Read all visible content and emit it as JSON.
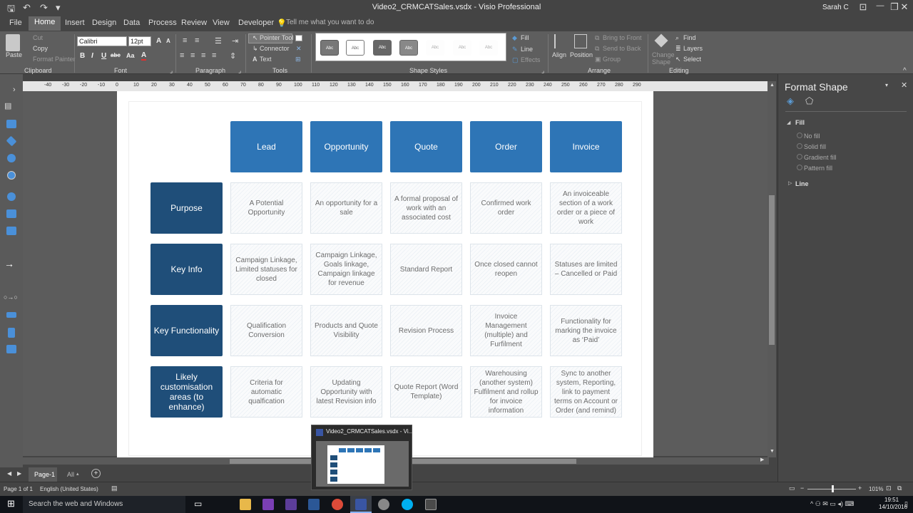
{
  "window": {
    "title": "Video2_CRMCATSales.vsdx - Visio Professional",
    "user": "Sarah C",
    "minimize": "—",
    "restore": "❐",
    "close": "✕",
    "help": "?"
  },
  "ribbon_tabs": [
    "File",
    "Home",
    "Insert",
    "Design",
    "Data",
    "Process",
    "Review",
    "View",
    "Developer"
  ],
  "tell_me": "Tell me what you want to do",
  "ribbon": {
    "clipboard": {
      "paste": "Paste",
      "cut": "Cut",
      "copy": "Copy",
      "format_painter": "Format Painter",
      "label": "Clipboard"
    },
    "font": {
      "family": "Calibri",
      "size": "12pt",
      "bold": "B",
      "italic": "I",
      "underline": "U",
      "strike": "abc",
      "size_label": "Aa",
      "grow": "A",
      "shrink": "A",
      "color": "A",
      "label": "Font"
    },
    "paragraph": {
      "label": "Paragraph"
    },
    "tools": {
      "pointer": "Pointer Tool",
      "connector": "Connector",
      "text": "Text",
      "label": "Tools"
    },
    "shape_styles": {
      "swatch": "Abc",
      "label": "Shape Styles"
    },
    "fill": "Fill",
    "line": "Line",
    "effects": "Effects",
    "arrange": {
      "bring_front": "Bring to Front",
      "send_back": "Send to Back",
      "group": "Group",
      "align": "Align",
      "position": "Position",
      "label": "Arrange"
    },
    "editing": {
      "change_shape": "Change Shape",
      "find": "Find",
      "layers": "Layers",
      "select": "Select",
      "label": "Editing"
    }
  },
  "ruler_ticks": [
    "-40",
    "-30",
    "-20",
    "-10",
    "0",
    "10",
    "20",
    "30",
    "40",
    "50",
    "60",
    "70",
    "80",
    "90",
    "100",
    "110",
    "120",
    "130",
    "140",
    "150",
    "160",
    "170",
    "180",
    "190",
    "200",
    "210",
    "220",
    "230",
    "240",
    "250",
    "260",
    "270",
    "280",
    "290"
  ],
  "diagram": {
    "headers": [
      "Lead",
      "Opportunity",
      "Quote",
      "Order",
      "Invoice"
    ],
    "rows": [
      {
        "label": "Purpose",
        "cells": [
          "A Potential Opportunity",
          "An opportunity for a sale",
          "A formal proposal of work with an associated cost",
          "Confirmed work order",
          "An invoiceable section of a work order or a piece of work"
        ]
      },
      {
        "label": "Key Info",
        "cells": [
          "Campaign Linkage, Limited statuses for closed",
          "Campaign Linkage, Goals linkage, Campaign linkage for revenue",
          "Standard Report",
          "Once closed cannot reopen",
          "Statuses are limited – Cancelled or Paid"
        ]
      },
      {
        "label": "Key Functionality",
        "cells": [
          "Qualification Conversion",
          "Products and Quote Visibility",
          "Revision Process",
          "Invoice Management (multiple) and Furfilment",
          "Functionality for marking the invoice as ‘Paid’"
        ]
      },
      {
        "label": "Likely customisation areas (to enhance)",
        "cells": [
          "Criteria for automatic qualfication",
          "Updating Opportunity with latest Revision info",
          "Quote Report (Word Template)",
          "Warehousing (another system) Fulfilment and rollup for invoice information",
          "Sync to another system, Reporting, link to payment terms on Account or Order (and remind)"
        ]
      }
    ]
  },
  "format_shape": {
    "title": "Format Shape",
    "fill_section": "Fill",
    "options": [
      "No fill",
      "Solid fill",
      "Gradient fill",
      "Pattern fill"
    ],
    "line_section": "Line"
  },
  "page_tabs": {
    "page1": "Page-1",
    "all": "All",
    "add": "+"
  },
  "status": {
    "page": "Page 1 of 1",
    "language": "English (United States)",
    "zoom": "101%"
  },
  "taskbar": {
    "search": "Search the web and Windows",
    "time": "19:51",
    "date": "14/10/2016"
  },
  "thumbnail": {
    "title": "Video2_CRMCATSales.vsdx - Vi..."
  },
  "colors": {
    "header_blue": "#2e75b6",
    "row_navy": "#1f4e79",
    "ribbon": "#5e5e5e"
  }
}
